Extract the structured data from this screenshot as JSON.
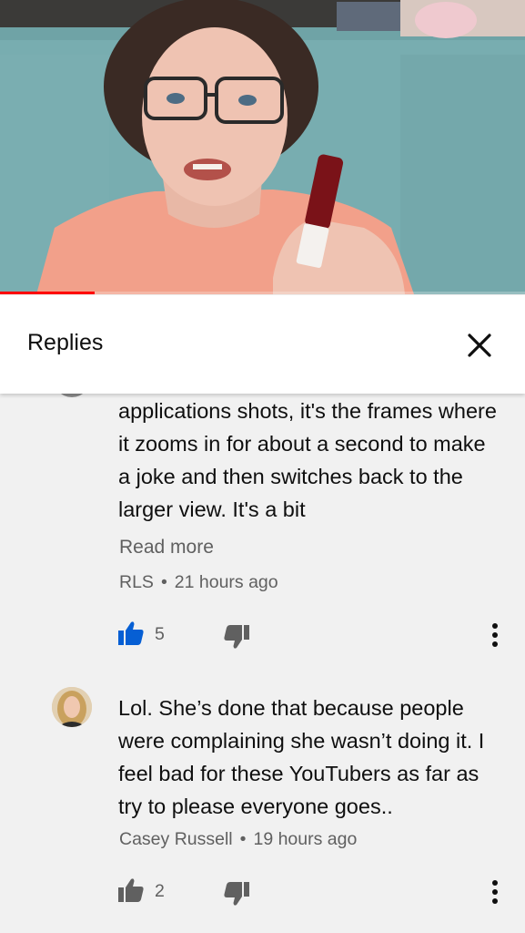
{
  "video": {
    "progress_fraction": 0.18,
    "progress_color": "#ff0000"
  },
  "header": {
    "title": "Replies",
    "close_icon": "close-icon"
  },
  "comments": [
    {
      "text": "applications shots, it's the frames where it zooms in for about a second to make a joke and then switches back to the larger view. It's a bit",
      "read_more": "Read more",
      "author": "RLS",
      "time": "21 hours ago",
      "likes": "5",
      "liked": true,
      "like_color": "#065fd4"
    },
    {
      "text": "Lol. She’s done that because people were complaining she wasn’t doing it. I feel bad for these YouTubers as far as try to please everyone goes..",
      "author": "Casey Russell",
      "time": "19 hours ago",
      "likes": "2",
      "liked": false
    }
  ]
}
